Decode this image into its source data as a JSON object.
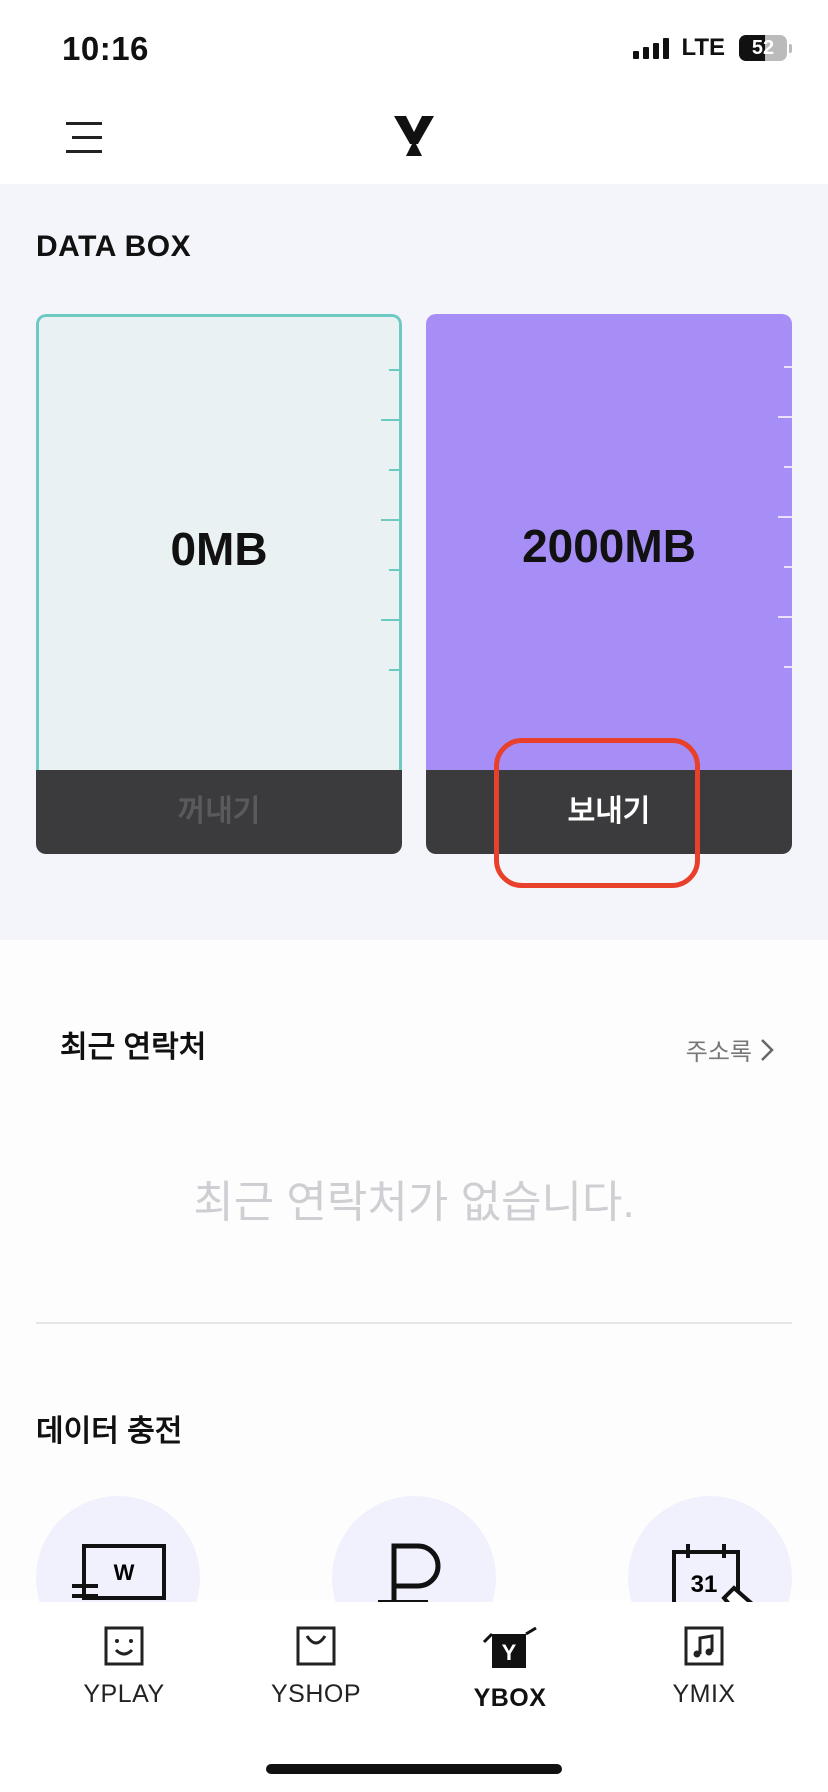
{
  "status_bar": {
    "time": "10:16",
    "network": "LTE",
    "battery": "52"
  },
  "header": {
    "menu_icon": "hamburger-menu-icon",
    "logo_icon": "y-logo-icon"
  },
  "data_box": {
    "title": "DATA BOX",
    "left_card": {
      "amount": "0MB",
      "button_label": "꺼내기",
      "accent": "#6dcac3"
    },
    "right_card": {
      "amount": "2000MB",
      "button_label": "보내기",
      "accent": "#a68ef6"
    }
  },
  "recent_contacts": {
    "title": "최근 연락처",
    "address_book_label": "주소록",
    "empty_message": "최근 연락처가 없습니다."
  },
  "data_charge": {
    "title": "데이터 충전",
    "items": [
      {
        "icon": "w-card-icon",
        "glyph": "W"
      },
      {
        "icon": "point-icon"
      },
      {
        "icon": "calendar-icon",
        "glyph": "31"
      }
    ]
  },
  "tab_bar": {
    "tabs": [
      {
        "label": "YPLAY",
        "icon": "smile-icon",
        "active": false
      },
      {
        "label": "YSHOP",
        "icon": "shopping-bag-icon",
        "active": false
      },
      {
        "label": "YBOX",
        "icon": "box-icon",
        "active": true
      },
      {
        "label": "YMIX",
        "icon": "music-note-icon",
        "active": false
      }
    ]
  },
  "colors": {
    "highlight": "#e8402a",
    "button_dark": "#3b3b3d",
    "section_bg": "#f4f5fb"
  }
}
